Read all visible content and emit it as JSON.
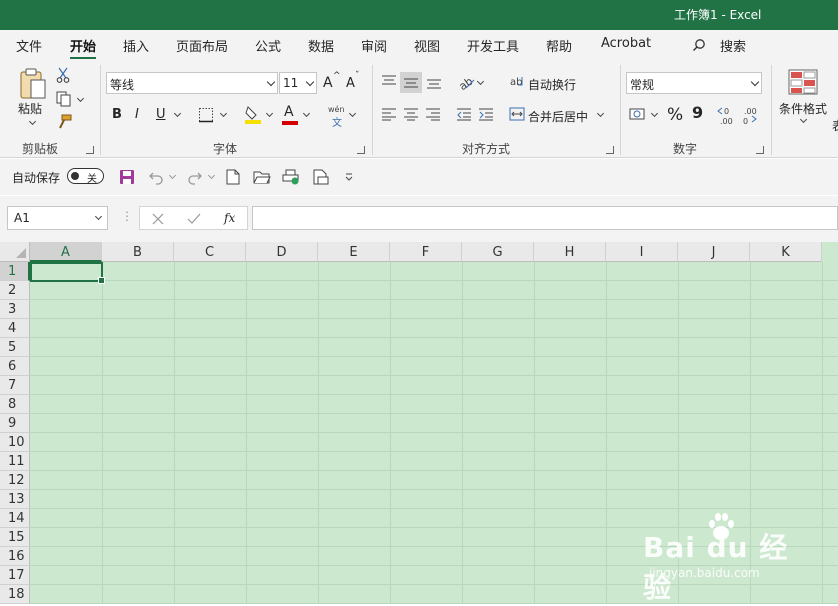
{
  "window": {
    "title": "工作簿1  -  Excel"
  },
  "tabs": [
    "文件",
    "开始",
    "插入",
    "页面布局",
    "公式",
    "数据",
    "审阅",
    "视图",
    "开发工具",
    "帮助",
    "Acrobat"
  ],
  "active_tab": "开始",
  "search": {
    "label": "搜索"
  },
  "ribbon": {
    "clipboard": {
      "paste_label": "粘贴",
      "group_label": "剪贴板"
    },
    "font": {
      "font_name": "等线",
      "font_size": "11",
      "group_label": "字体",
      "bold": "B",
      "italic": "I",
      "underline": "U",
      "grow": "A",
      "shrink": "A",
      "font_color_letter": "A",
      "pinyin_top": "wén",
      "pinyin_bottom": "文"
    },
    "alignment": {
      "wrap_text": "自动换行",
      "merge_center": "合并后居中",
      "group_label": "对齐方式"
    },
    "number": {
      "format": "常规",
      "group_label": "数字",
      "percent": "%",
      "comma": "9",
      "inc_dec": ".00",
      "dec_dec": ".00"
    },
    "styles": {
      "conditional_format": "条件格式",
      "cut_label": "表"
    }
  },
  "qat": {
    "autosave_label": "自动保存",
    "autosave_state": "关"
  },
  "formula_bar": {
    "name_box": "A1",
    "fx": "fx",
    "formula": ""
  },
  "sheet": {
    "columns": [
      "A",
      "B",
      "C",
      "D",
      "E",
      "F",
      "G",
      "H",
      "I",
      "J",
      "K"
    ],
    "rows": [
      "1",
      "2",
      "3",
      "4",
      "5",
      "6",
      "7",
      "8",
      "9",
      "10",
      "11",
      "12",
      "13",
      "14",
      "15",
      "16",
      "17",
      "18"
    ],
    "selected_cell": "A1"
  },
  "watermark": {
    "brand": "Bai du 经验",
    "url": "jingyan.baidu.com"
  },
  "colors": {
    "accent": "#217346",
    "grid_bg": "#cce8cf",
    "ribbon_bg": "#f3f3f3"
  }
}
